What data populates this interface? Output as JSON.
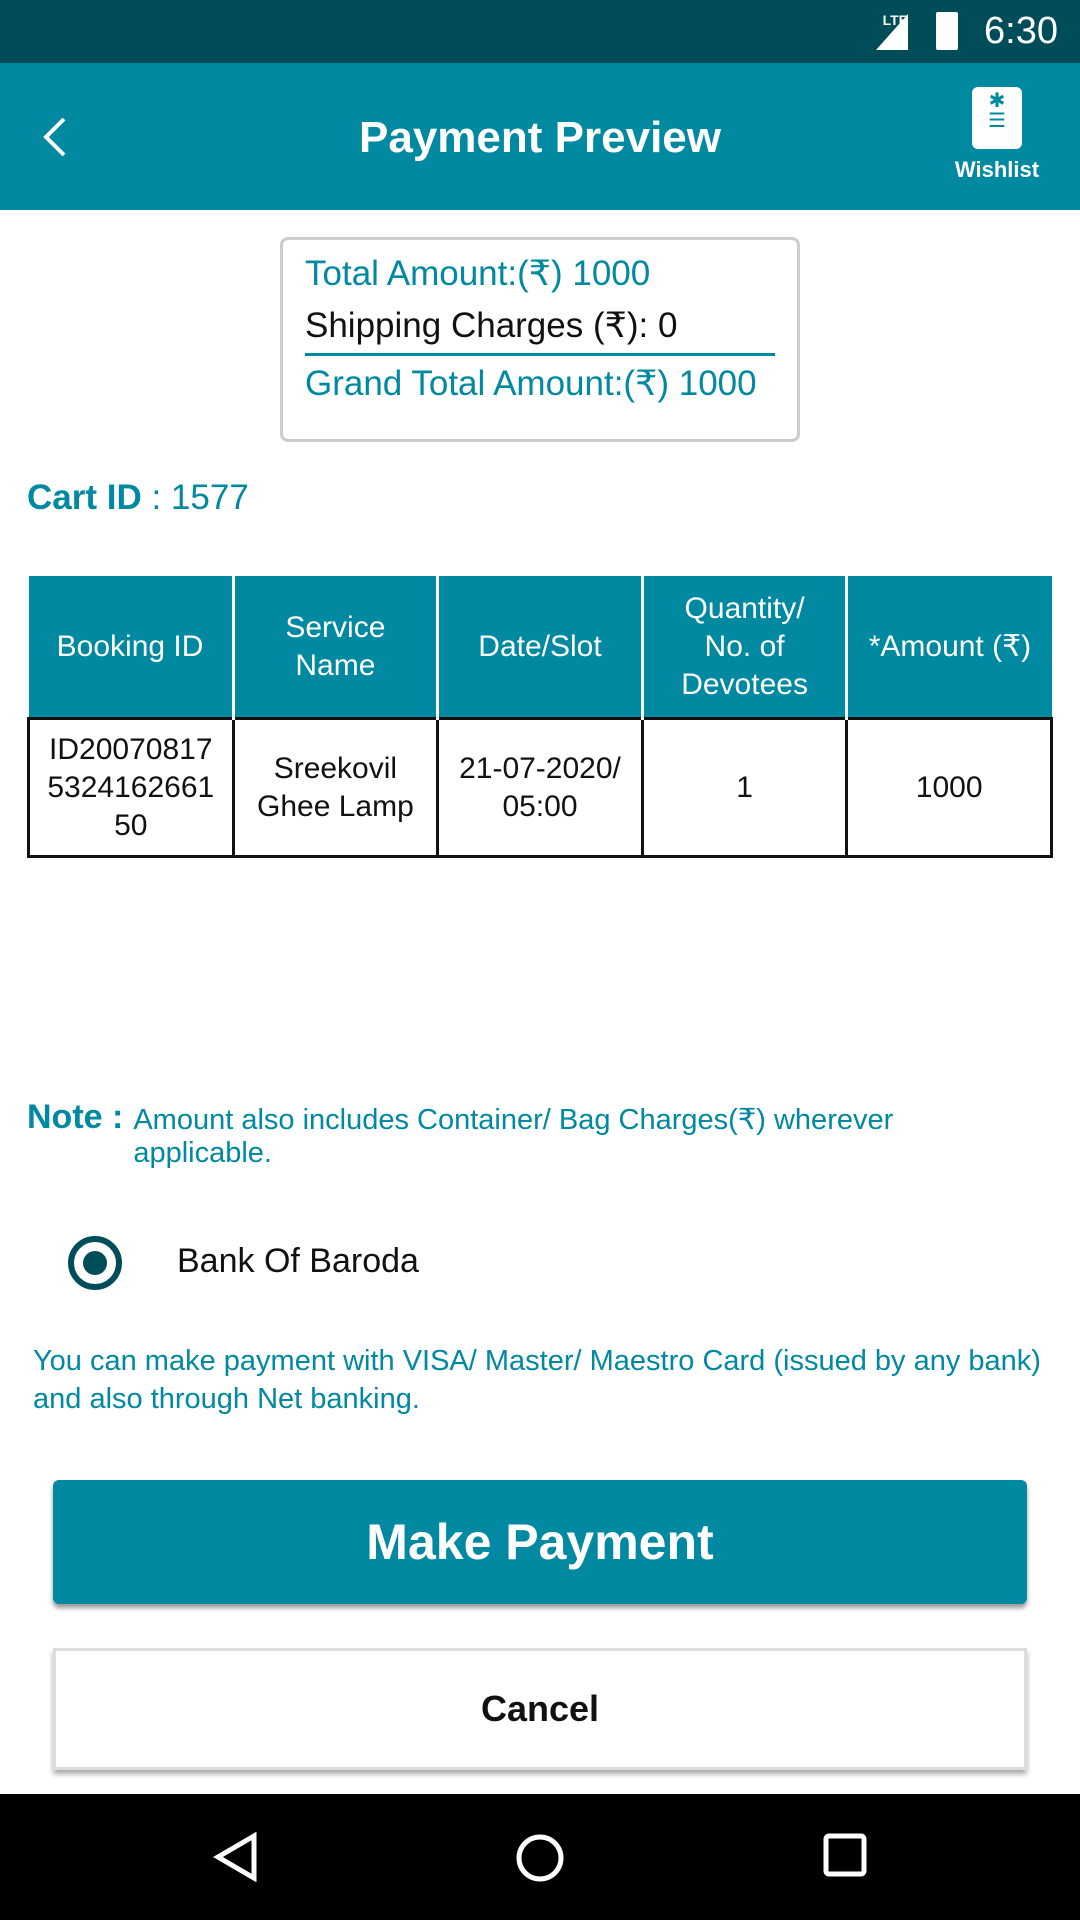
{
  "status_bar": {
    "network": "LTE",
    "time": "6:30"
  },
  "app_bar": {
    "title": "Payment Preview",
    "wishlist_label": "Wishlist"
  },
  "summary": {
    "total": "Total Amount:(₹) 1000",
    "shipping": "Shipping Charges (₹): 0",
    "grand_total": "Grand Total Amount:(₹) 1000"
  },
  "cart": {
    "label": "Cart ID",
    "value": " : 1577"
  },
  "table": {
    "headers": [
      "Booking ID",
      "Service Name",
      "Date/Slot",
      "Quantity/ No. of Devotees",
      "*Amount (₹)"
    ],
    "rows": [
      [
        "ID200708175324162661 50",
        "Sreekovil Ghee Lamp",
        "21-07-2020/ 05:00",
        "1",
        "1000"
      ]
    ]
  },
  "note": {
    "label": "Note :",
    "text": "Amount also includes Container/ Bag Charges(₹) wherever applicable."
  },
  "payment_option": {
    "label": "Bank Of Baroda",
    "selected": true
  },
  "info": "You can make payment with VISA/ Master/ Maestro Card (issued by any bank) and also through Net banking.",
  "buttons": {
    "pay": "Make Payment",
    "cancel": "Cancel"
  },
  "colors": {
    "primary": "#0089a0",
    "status_bar": "#004d5a"
  }
}
